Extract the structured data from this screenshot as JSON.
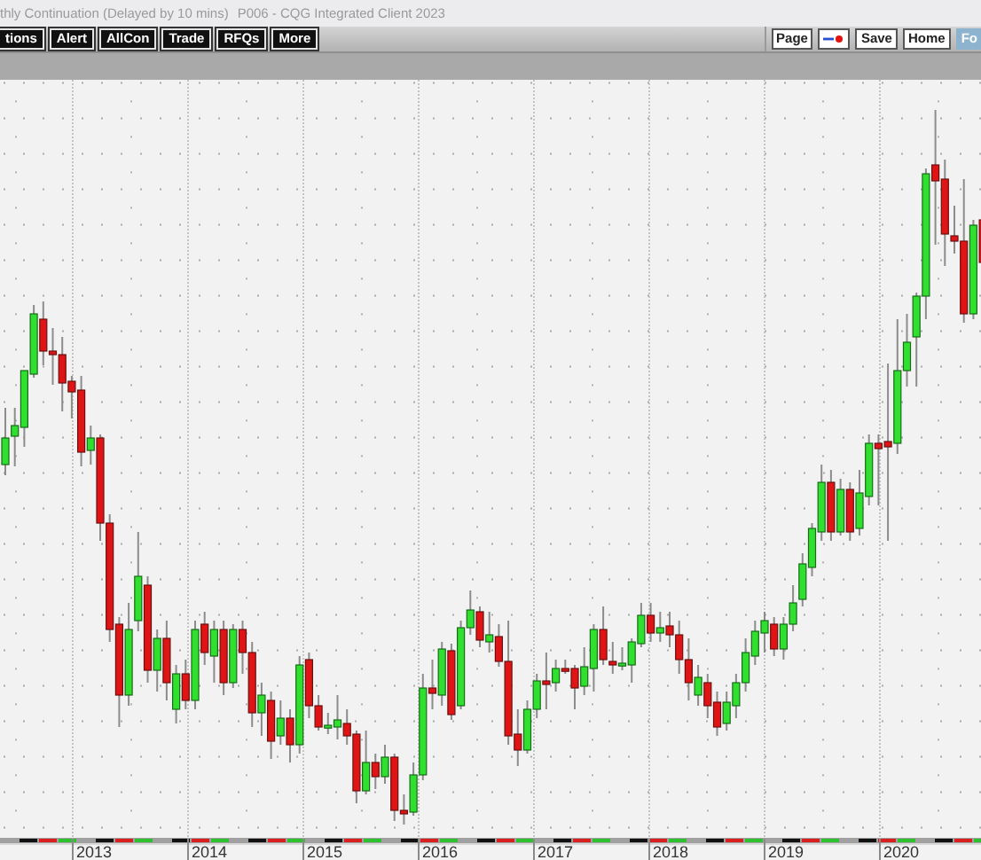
{
  "title_bar": {
    "caption": "thly Continuation (Delayed by 10 mins)",
    "client": "P006 - CQG Integrated Client 2023"
  },
  "toolbar": {
    "menu_buttons": [
      "tions",
      "Alert",
      "AllCon",
      "Trade",
      "RFQs",
      "More"
    ],
    "page_buttons": [
      {
        "kind": "text",
        "label": "Page",
        "selected": false
      },
      {
        "kind": "icon",
        "selected": false
      },
      {
        "kind": "text",
        "label": "Save",
        "selected": false
      },
      {
        "kind": "text",
        "label": "Home",
        "selected": false
      },
      {
        "kind": "text",
        "label": "Fo",
        "selected": true
      }
    ]
  },
  "chart": {
    "x_axis_labels": [
      "2013",
      "2014",
      "2015",
      "2016",
      "2017",
      "2018",
      "2019",
      "2020"
    ]
  }
}
